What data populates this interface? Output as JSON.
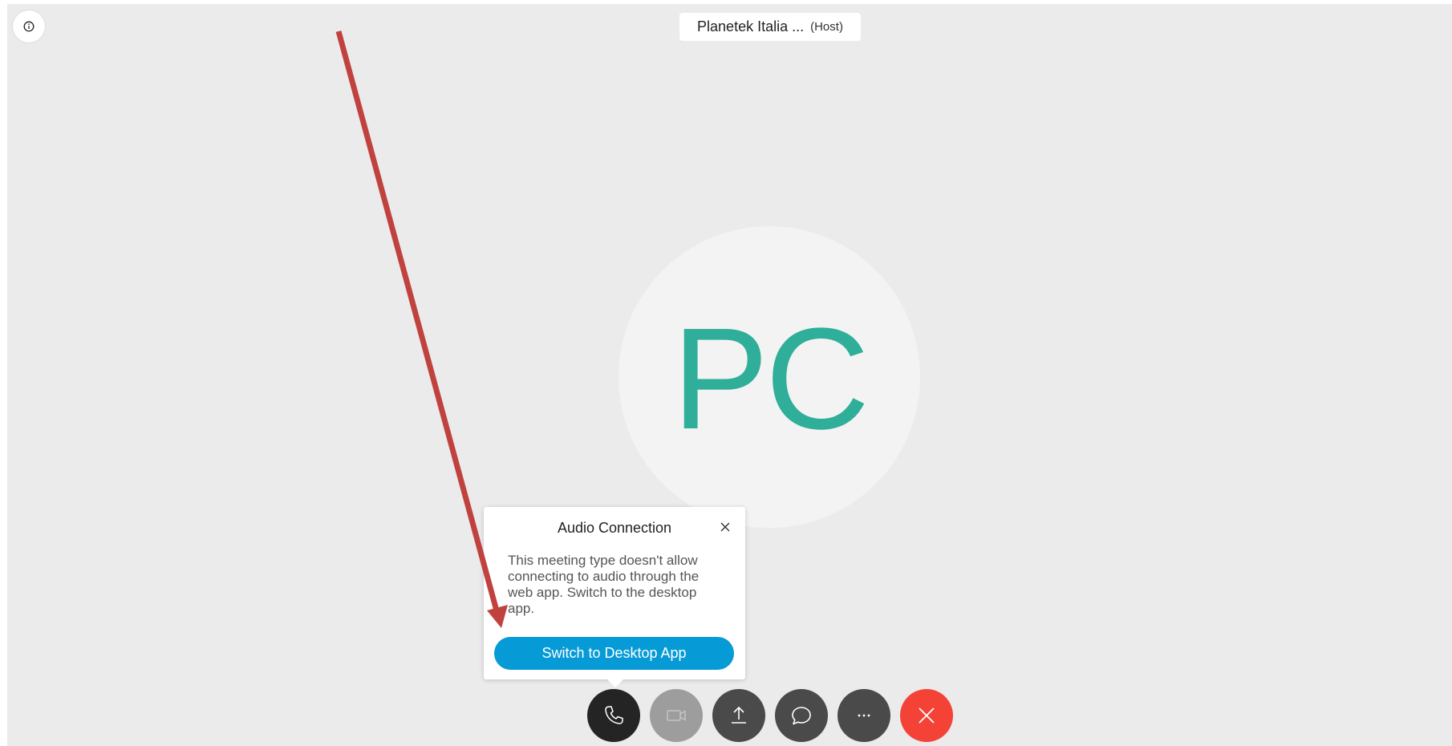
{
  "header": {
    "host_name": "Planetek Italia ...",
    "host_role": "(Host)"
  },
  "avatar": {
    "initials": "PC",
    "color": "#2fae99"
  },
  "audio_popup": {
    "title": "Audio Connection",
    "message": "This meeting type doesn't allow connecting to audio through the web app. Switch to the desktop app.",
    "action_label": "Switch to Desktop App",
    "action_color": "#069bd6"
  },
  "annotation": {
    "arrow_color": "#c0423e"
  },
  "controls": [
    {
      "name": "audio",
      "icon": "phone-icon"
    },
    {
      "name": "video",
      "icon": "camera-icon"
    },
    {
      "name": "share",
      "icon": "upload-icon"
    },
    {
      "name": "chat",
      "icon": "chat-bubble-icon"
    },
    {
      "name": "more",
      "icon": "ellipsis-icon"
    },
    {
      "name": "leave",
      "icon": "close-icon",
      "color": "#f44336"
    }
  ]
}
